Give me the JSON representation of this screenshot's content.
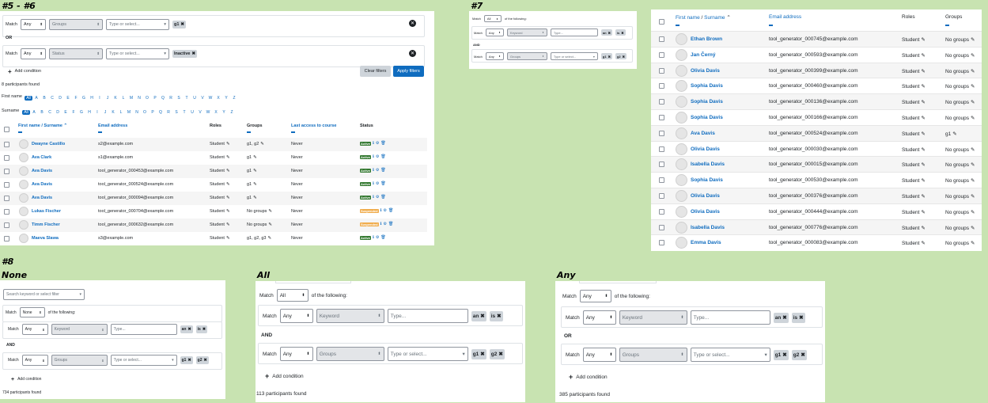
{
  "labels": {
    "l56": "#5 - #6",
    "l7": "#7",
    "l8": "#8",
    "none": "None",
    "all": "All",
    "any": "Any"
  },
  "p1": {
    "row1": {
      "match": "Match",
      "any": "Any",
      "field": "Groups",
      "placeholder": "Type or select...",
      "tags": [
        "g1"
      ]
    },
    "or": "OR",
    "row2": {
      "match": "Match",
      "any": "Any",
      "field": "Status",
      "placeholder": "Type or select...",
      "tags": [
        "Inactive"
      ]
    },
    "add": "Add condition",
    "clear": "Clear filters",
    "apply": "Apply filters",
    "found": "8 participants found",
    "firstname": "First name",
    "surname": "Surname",
    "all": "All",
    "letters": [
      "A",
      "B",
      "C",
      "D",
      "E",
      "F",
      "G",
      "H",
      "I",
      "J",
      "K",
      "L",
      "M",
      "N",
      "O",
      "P",
      "Q",
      "R",
      "S",
      "T",
      "U",
      "V",
      "W",
      "X",
      "Y",
      "Z"
    ],
    "headers": {
      "name": "First name / Surname",
      "email": "Email address",
      "roles": "Roles",
      "groups": "Groups",
      "access": "Last access to course",
      "status": "Status"
    },
    "rows": [
      {
        "name": "Dwayne Castillo",
        "email": "s2@example.com",
        "role": "Student",
        "groups": "g1, g2",
        "access": "Never",
        "status": "Active"
      },
      {
        "name": "Ava Clark",
        "email": "s1@example.com",
        "role": "Student",
        "groups": "g1",
        "access": "Never",
        "status": "Active"
      },
      {
        "name": "Ava Davis",
        "email": "tool_generator_000453@example.com",
        "role": "Student",
        "groups": "g1",
        "access": "Never",
        "status": "Active"
      },
      {
        "name": "Ava Davis",
        "email": "tool_generator_000524@example.com",
        "role": "Student",
        "groups": "g1",
        "access": "Never",
        "status": "Active"
      },
      {
        "name": "Ava Davis",
        "email": "tool_generator_000094@example.com",
        "role": "Student",
        "groups": "g1",
        "access": "Never",
        "status": "Active"
      },
      {
        "name": "Lukas Fischer",
        "email": "tool_generator_000704@example.com",
        "role": "Student",
        "groups": "No groups",
        "access": "Never",
        "status": "Suspended"
      },
      {
        "name": "Timm Fischer",
        "email": "tool_generator_000632@example.com",
        "role": "Student",
        "groups": "No groups",
        "access": "Never",
        "status": "Suspended"
      },
      {
        "name": "Maeva Slawa",
        "email": "s3@example.com",
        "role": "Student",
        "groups": "g1, g2, g3",
        "access": "Never",
        "status": "Active"
      }
    ]
  },
  "p7": {
    "match": "Match",
    "all": "All",
    "following": "of the following:",
    "row1": {
      "match": "Match",
      "any": "Any",
      "field": "Keyword",
      "placeholder": "Type...",
      "tags": [
        "an",
        "is"
      ]
    },
    "and": "AND",
    "row2": {
      "match": "Match",
      "any": "Any",
      "field": "Groups",
      "placeholder": "Type or select...",
      "tags": [
        "g1",
        "g2"
      ]
    }
  },
  "p3": {
    "headers": {
      "name": "First name",
      "slash": " / ",
      "surname": "Surname",
      "email": "Email address",
      "roles": "Roles",
      "groups": "Groups"
    },
    "rows": [
      {
        "name": "Ethan Brown",
        "email": "tool_generator_000745@example.com",
        "role": "Student",
        "groups": "No groups"
      },
      {
        "name": "Jan Černý",
        "email": "tool_generator_000593@example.com",
        "role": "Student",
        "groups": "No groups"
      },
      {
        "name": "Olivia Davis",
        "email": "tool_generator_000399@example.com",
        "role": "Student",
        "groups": "No groups"
      },
      {
        "name": "Sophia Davis",
        "email": "tool_generator_000460@example.com",
        "role": "Student",
        "groups": "No groups"
      },
      {
        "name": "Sophia Davis",
        "email": "tool_generator_000136@example.com",
        "role": "Student",
        "groups": "No groups"
      },
      {
        "name": "Sophia Davis",
        "email": "tool_generator_000166@example.com",
        "role": "Student",
        "groups": "No groups"
      },
      {
        "name": "Ava Davis",
        "email": "tool_generator_000524@example.com",
        "role": "Student",
        "groups": "g1"
      },
      {
        "name": "Olivia Davis",
        "email": "tool_generator_000030@example.com",
        "role": "Student",
        "groups": "No groups"
      },
      {
        "name": "Isabella Davis",
        "email": "tool_generator_000015@example.com",
        "role": "Student",
        "groups": "No groups"
      },
      {
        "name": "Sophia Davis",
        "email": "tool_generator_000530@example.com",
        "role": "Student",
        "groups": "No groups"
      },
      {
        "name": "Olivia Davis",
        "email": "tool_generator_000376@example.com",
        "role": "Student",
        "groups": "No groups"
      },
      {
        "name": "Olivia Davis",
        "email": "tool_generator_000444@example.com",
        "role": "Student",
        "groups": "No groups"
      },
      {
        "name": "Isabella Davis",
        "email": "tool_generator_000776@example.com",
        "role": "Student",
        "groups": "No groups"
      },
      {
        "name": "Emma Davis",
        "email": "tool_generator_000083@example.com",
        "role": "Student",
        "groups": "No groups"
      }
    ]
  },
  "pn": {
    "search": "Search keyword or select filter",
    "match": "Match",
    "none": "None",
    "following": "of the following:",
    "row1": {
      "match": "Match",
      "any": "Any",
      "field": "Keyword",
      "placeholder": "Type...",
      "tags": [
        "an",
        "is"
      ]
    },
    "and": "AND",
    "row2": {
      "match": "Match",
      "any": "Any",
      "field": "Groups",
      "placeholder": "Type or select...",
      "tags": [
        "g1",
        "g2"
      ]
    },
    "add": "Add condition",
    "found": "734 participants found"
  },
  "pa": {
    "match": "Match",
    "all": "All",
    "following": "of the following:",
    "row1": {
      "match": "Match",
      "any": "Any",
      "field": "Keyword",
      "placeholder": "Type...",
      "tags": [
        "an",
        "is"
      ]
    },
    "and": "AND",
    "row2": {
      "match": "Match",
      "any": "Any",
      "field": "Groups",
      "placeholder": "Type or select...",
      "tags": [
        "g1",
        "g2"
      ]
    },
    "add": "Add condition",
    "found": "113 participants found"
  },
  "py": {
    "match": "Match",
    "any": "Any",
    "following": "of the following:",
    "row1": {
      "match": "Match",
      "any": "Any",
      "field": "Keyword",
      "placeholder": "Type...",
      "tags": [
        "an",
        "is"
      ]
    },
    "or": "OR",
    "row2": {
      "match": "Match",
      "any": "Any",
      "field": "Groups",
      "placeholder": "Type or select...",
      "tags": [
        "g1",
        "g2"
      ]
    },
    "add": "Add condition",
    "found": "385 participants found"
  }
}
